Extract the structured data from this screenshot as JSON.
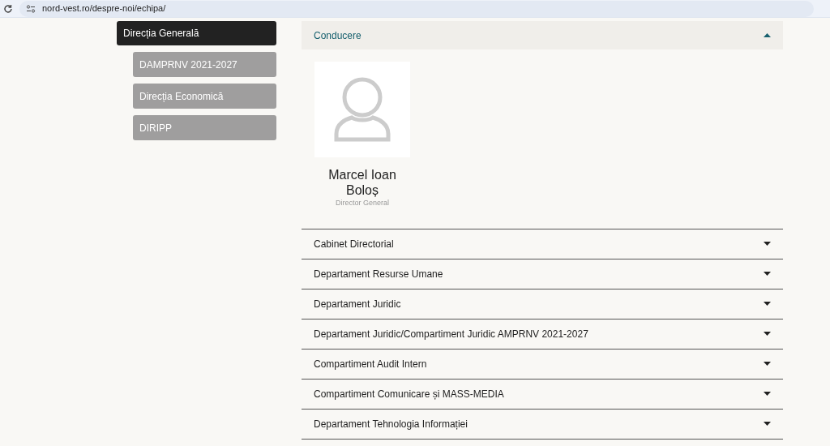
{
  "browser": {
    "url": "nord-vest.ro/despre-noi/echipa/"
  },
  "sidebar": {
    "items": [
      {
        "label": "Direcția Generală",
        "selected": true,
        "children": [
          {
            "label": "DAMPRNV 2021-2027",
            "selected": false
          },
          {
            "label": "Direcția Economică",
            "selected": false
          },
          {
            "label": "DIRIPP",
            "selected": false
          }
        ]
      }
    ]
  },
  "sections": [
    {
      "title": "Conducere",
      "expanded": true,
      "members": [
        {
          "name": "Marcel Ioan Boloș",
          "role": "Director General"
        }
      ]
    },
    {
      "title": "Cabinet Directorial",
      "expanded": false
    },
    {
      "title": "Departament Resurse Umane",
      "expanded": false
    },
    {
      "title": "Departament Juridic",
      "expanded": false
    },
    {
      "title": "Departament Juridic/Compartiment Juridic AMPRNV 2021-2027",
      "expanded": false
    },
    {
      "title": "Compartiment Audit Intern",
      "expanded": false
    },
    {
      "title": "Compartiment Comunicare și MASS-MEDIA",
      "expanded": false
    },
    {
      "title": "Departament Tehnologia Informației",
      "expanded": false
    }
  ]
}
